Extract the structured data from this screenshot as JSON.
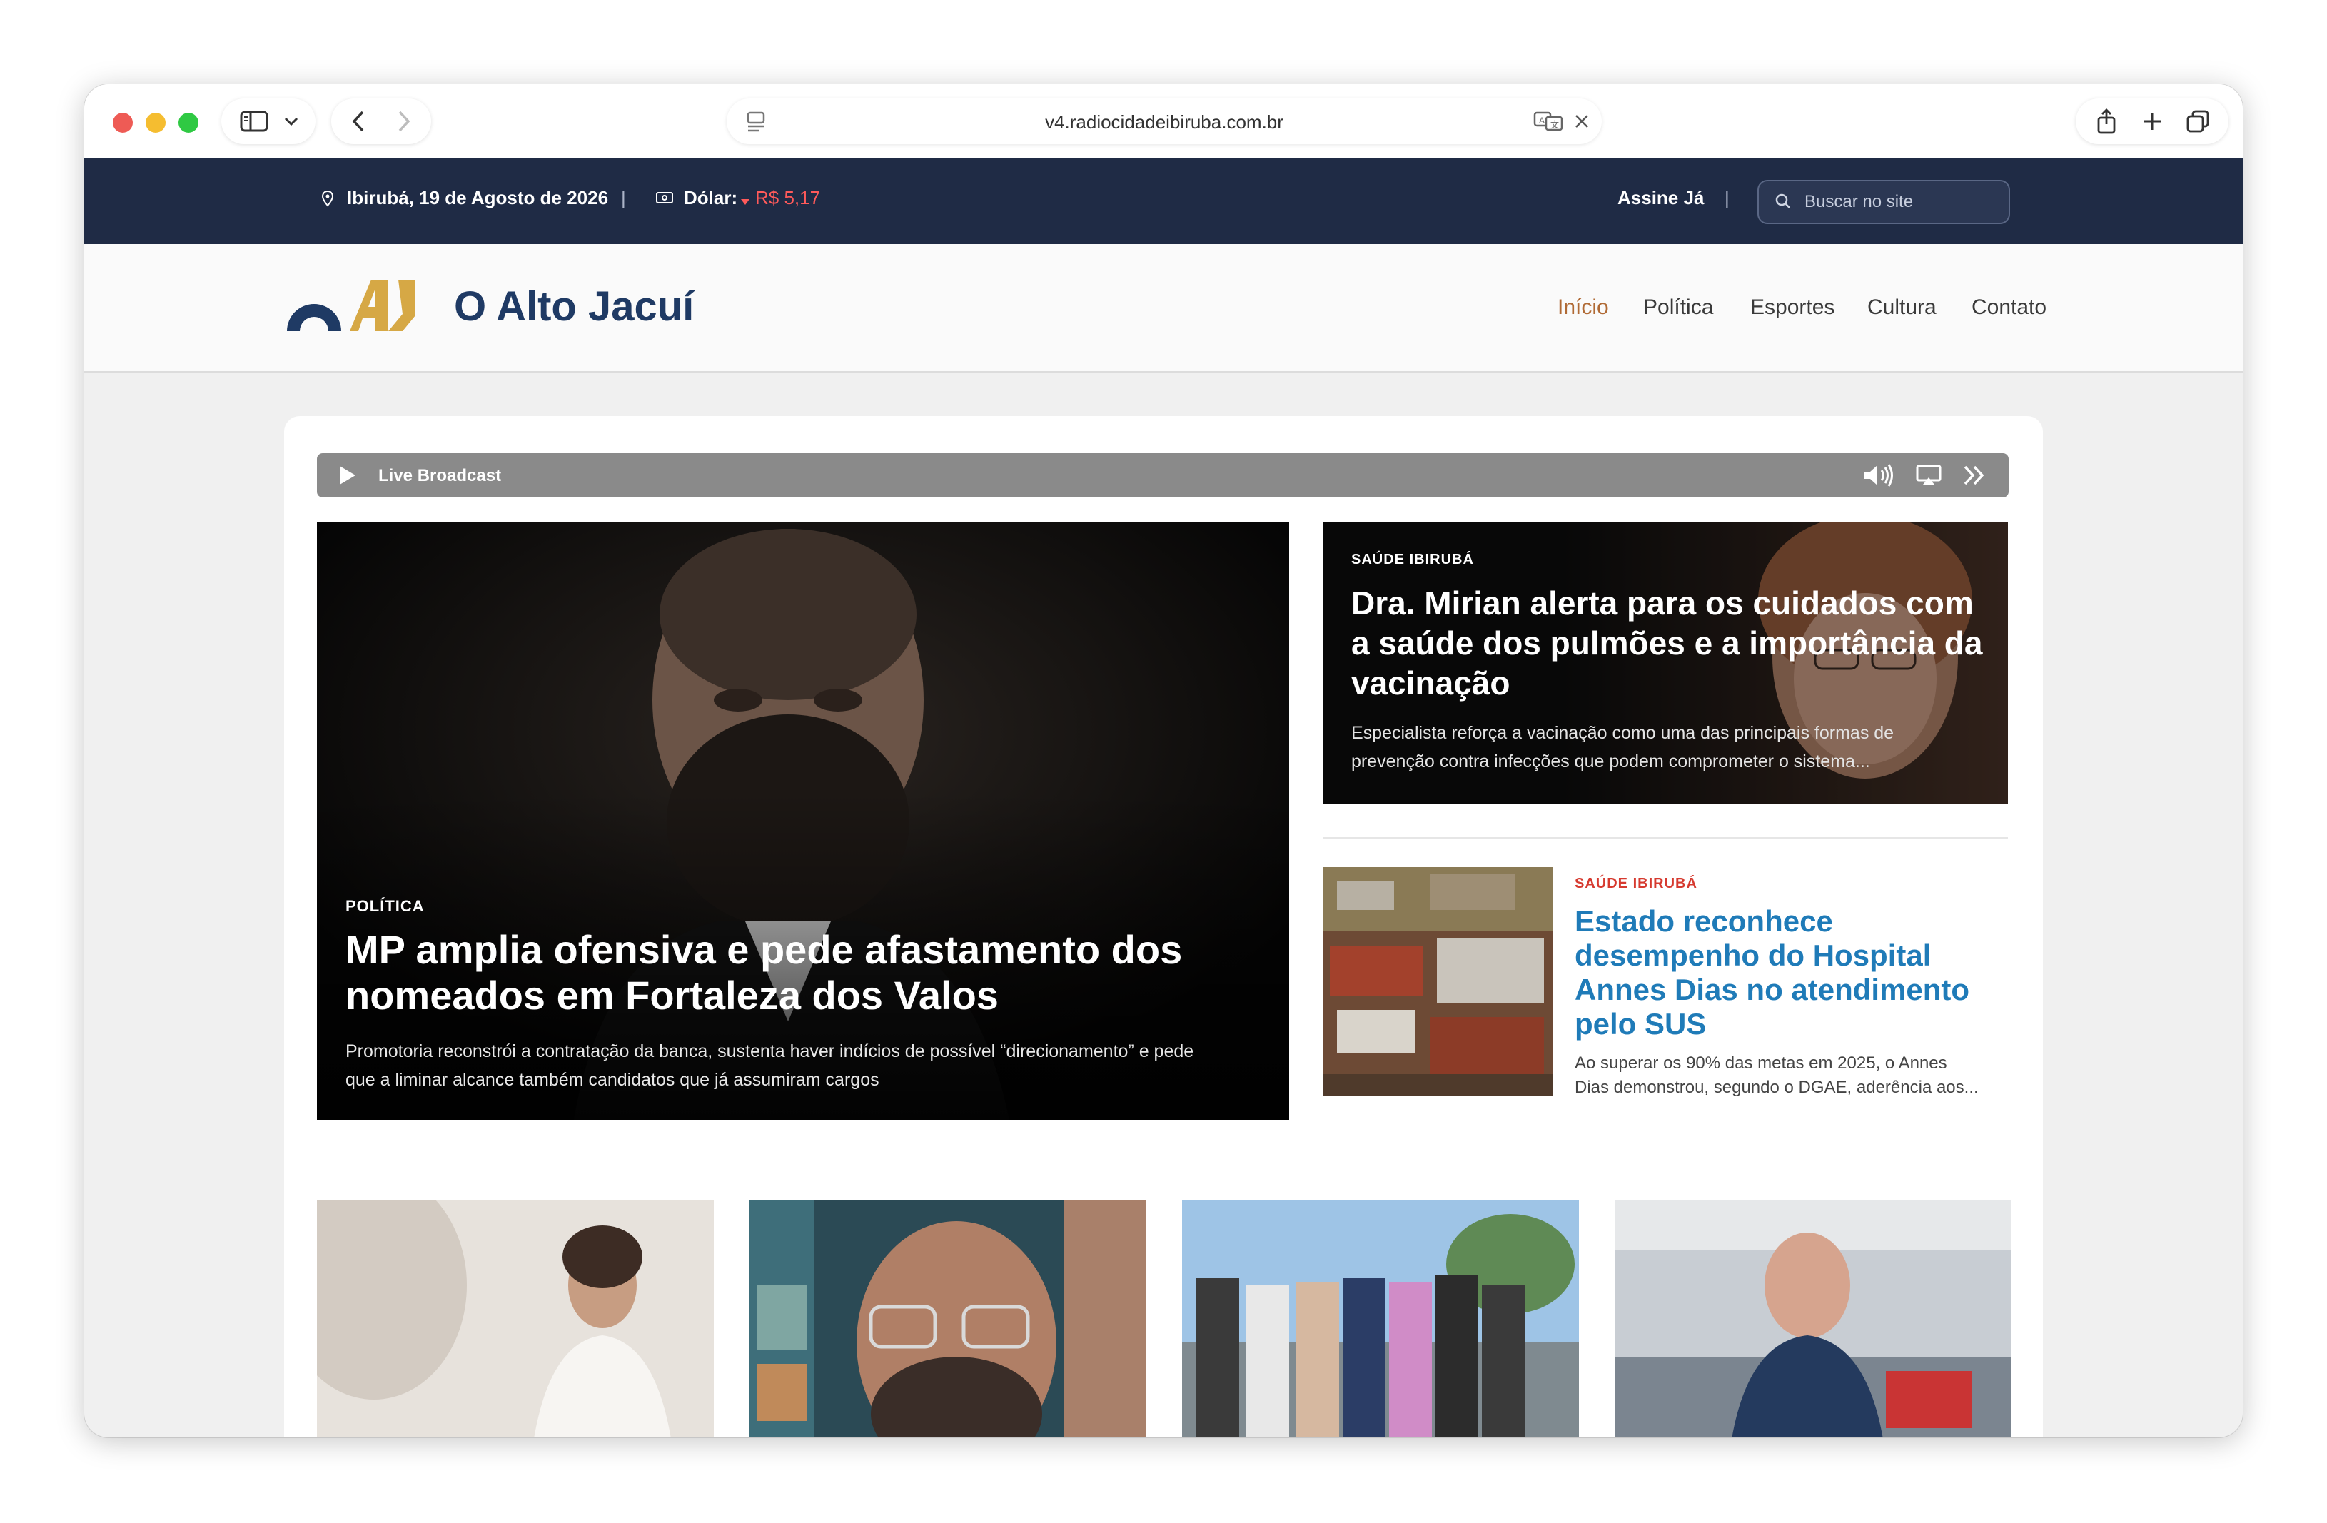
{
  "browser": {
    "url": "v4.radiocidadeibiruba.com.br",
    "colors": {
      "close": "#ee5b55",
      "minimize": "#f5bd30",
      "maximize": "#2fc943"
    },
    "icons": [
      "sidebar-icon",
      "chevron-down-icon",
      "back-icon",
      "forward-icon",
      "reader-icon",
      "translate-icon",
      "close-icon",
      "share-icon",
      "new-tab-icon",
      "tabs-overview-icon"
    ]
  },
  "topbar": {
    "location_date": "Ibirubá, 19 de Agosto de 2026",
    "separator": "|",
    "dollar_label": "Dólar:",
    "dollar_value": "R$ 5,17",
    "subscribe": "Assine Já",
    "search_placeholder": "Buscar no site",
    "colors": {
      "background": "#1f2b45",
      "dollar": "#ff5a5a"
    }
  },
  "header": {
    "logo_mark": "OAJ",
    "logo_text": "O Alto Jacuí",
    "nav": [
      {
        "label": "Início",
        "active": true
      },
      {
        "label": "Política"
      },
      {
        "label": "Esportes"
      },
      {
        "label": "Cultura"
      },
      {
        "label": "Contato"
      }
    ],
    "colors": {
      "active": "#b06a35",
      "logo_blue": "#1f3a64",
      "logo_gold": "#d6a845"
    }
  },
  "player": {
    "label": "Live Broadcast",
    "icons": [
      "play-icon",
      "volume-icon",
      "airplay-icon",
      "fast-forward-icon"
    ]
  },
  "hero": {
    "kicker": "POLÍTICA",
    "title_line1": "MP amplia ofensiva e pede afastamento dos",
    "title_line2": "nomeados em Fortaleza dos Valos",
    "summary_line1": "Promotoria reconstrói a contratação da banca, sustenta haver indícios de possível “direcionamento” e pede",
    "summary_line2": "que a liminar alcance também candidatos que já assumiram cargos"
  },
  "side1": {
    "kicker": "SAÚDE IBIRUBÁ",
    "title_line1": "Dra. Mirian alerta para os cuidados com",
    "title_line2": "a saúde dos pulmões e a importância da",
    "title_line3": "vacinação",
    "summary_line1": "Especialista reforça a vacinação como uma das principais formas de",
    "summary_line2": "prevenção contra infecções que podem comprometer o sistema..."
  },
  "side2": {
    "kicker": "SAÚDE IBIRUBÁ",
    "title_line1": "Estado reconhece",
    "title_line2": "desempenho do Hospital",
    "title_line3": "Annes Dias no atendimento",
    "title_line4": "pelo SUS",
    "summary_line1": "Ao superar os 90% das metas em 2025, o Annes",
    "summary_line2": "Dias demonstrou, segundo o DGAE, aderência aos...",
    "colors": {
      "kicker": "#d63a2f",
      "title": "#1f7bb8"
    }
  },
  "thumbnails": [
    {
      "name": "thumb-woman-white-suit"
    },
    {
      "name": "thumb-man-glasses-bookshelf"
    },
    {
      "name": "thumb-group-photo"
    },
    {
      "name": "thumb-man-event-hall"
    }
  ]
}
